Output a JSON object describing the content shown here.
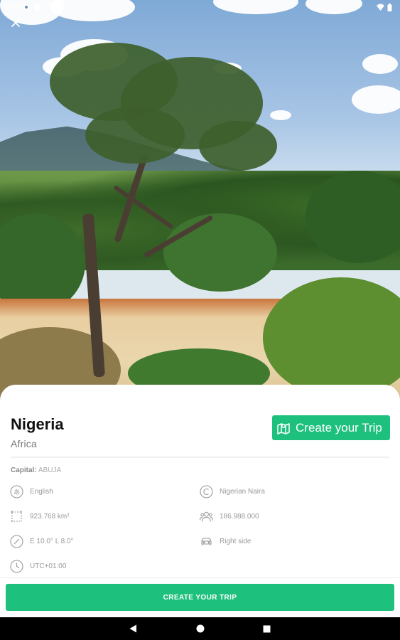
{
  "status_bar": {
    "time": "3:00"
  },
  "country": {
    "name": "Nigeria",
    "continent": "Africa",
    "capital_label": "Capital:",
    "capital_value": "ABUJA"
  },
  "actions": {
    "create_trip_top": "Create your Trip",
    "create_trip_bottom": "CREATE YOUR TRIP"
  },
  "info": {
    "language": "English",
    "currency": "Nigerian Naira",
    "area": "923.768 km²",
    "population": "186.988.000",
    "coordinates": "E 10.0° L 8.0°",
    "driving_side": "Right side",
    "timezone": "UTC+01:00"
  },
  "icons": {
    "close": "close-icon",
    "map": "map-icon",
    "language": "language-icon",
    "currency": "currency-icon",
    "area": "area-icon",
    "population": "population-icon",
    "coordinates": "compass-icon",
    "driving": "car-icon",
    "timezone": "clock-icon"
  },
  "colors": {
    "accent": "#1ec07d",
    "text": "#111111",
    "muted": "#9a9a9a"
  }
}
